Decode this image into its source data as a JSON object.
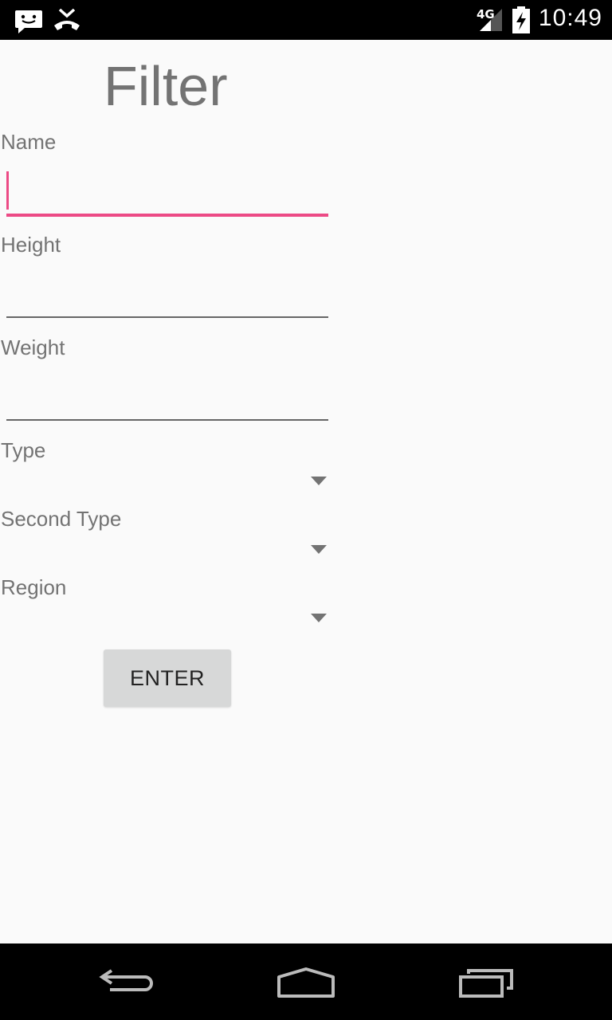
{
  "status_bar": {
    "time": "10:49",
    "network": "4G",
    "icons": [
      "message-icon",
      "missed-call-icon",
      "signal-icon",
      "battery-charging-icon"
    ]
  },
  "form": {
    "title": "Filter",
    "name_label": "Name",
    "name_value": "",
    "height_label": "Height",
    "height_value": "",
    "weight_label": "Weight",
    "weight_value": "",
    "type_label": "Type",
    "type_value": "",
    "second_type_label": "Second Type",
    "second_type_value": "",
    "region_label": "Region",
    "region_value": "",
    "enter_label": "ENTER"
  },
  "nav_bar": {
    "icons": [
      "back-icon",
      "home-icon",
      "recents-icon"
    ]
  },
  "colors": {
    "accent": "#ec4a85",
    "status_bar": "#000000",
    "background": "#fafafa",
    "text_secondary": "#737373",
    "button": "#d7d8d8"
  }
}
